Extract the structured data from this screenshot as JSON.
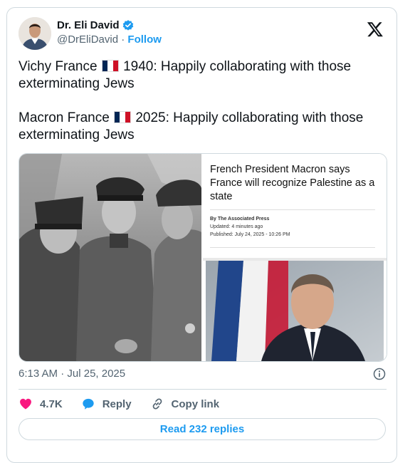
{
  "author": {
    "display_name": "Dr. Eli David",
    "handle": "@DrEliDavid",
    "separator": "·",
    "follow_label": "Follow",
    "verified_color": "#1d9bf0"
  },
  "tweet": {
    "line1_prefix": "Vichy France",
    "line1_suffix": " 1940: Happily collaborating with those exterminating Jews",
    "line2_prefix": "Macron France",
    "line2_suffix": " 2025: Happily collaborating with those exterminating Jews",
    "flag": "flag-france-icon"
  },
  "media": {
    "left_photo": "black-and-white-wartime-photo",
    "article": {
      "headline": "French President Macron says France will recognize Palestine as a state",
      "byline": "By The Associated Press",
      "updated": "Updated: 4 minutes ago",
      "published": "Published: July 24, 2025 - 10:26 PM"
    },
    "right_photo": "macron-with-flag-photo"
  },
  "timestamp": {
    "time": "6:13 AM",
    "separator": "·",
    "date": "Jul 25, 2025"
  },
  "actions": {
    "likes": "4.7K",
    "reply_label": "Reply",
    "copy_label": "Copy link",
    "like_color": "#f91880",
    "reply_color": "#1d9bf0"
  },
  "read_replies_label": "Read 232 replies"
}
